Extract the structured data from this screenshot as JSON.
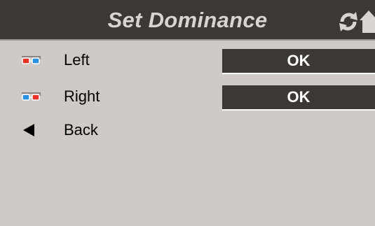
{
  "header": {
    "title": "Set Dominance",
    "refresh_icon": "refresh-icon",
    "home_icon": "home-icon"
  },
  "rows": [
    {
      "label": "Left",
      "icon": "3d-glasses-icon",
      "button_label": "OK"
    },
    {
      "label": "Right",
      "icon": "3d-glasses-icon",
      "button_label": "OK"
    },
    {
      "label": "Back",
      "icon": "back-arrow-icon"
    }
  ],
  "colors": {
    "background": "#cfcac6",
    "header_bg": "#3b3836",
    "title_text": "#d9d4cf",
    "button_bg": "#3b3836",
    "button_text": "#ffffff",
    "glasses_red": "#e8322a",
    "glasses_cyan": "#2a8fe0"
  }
}
